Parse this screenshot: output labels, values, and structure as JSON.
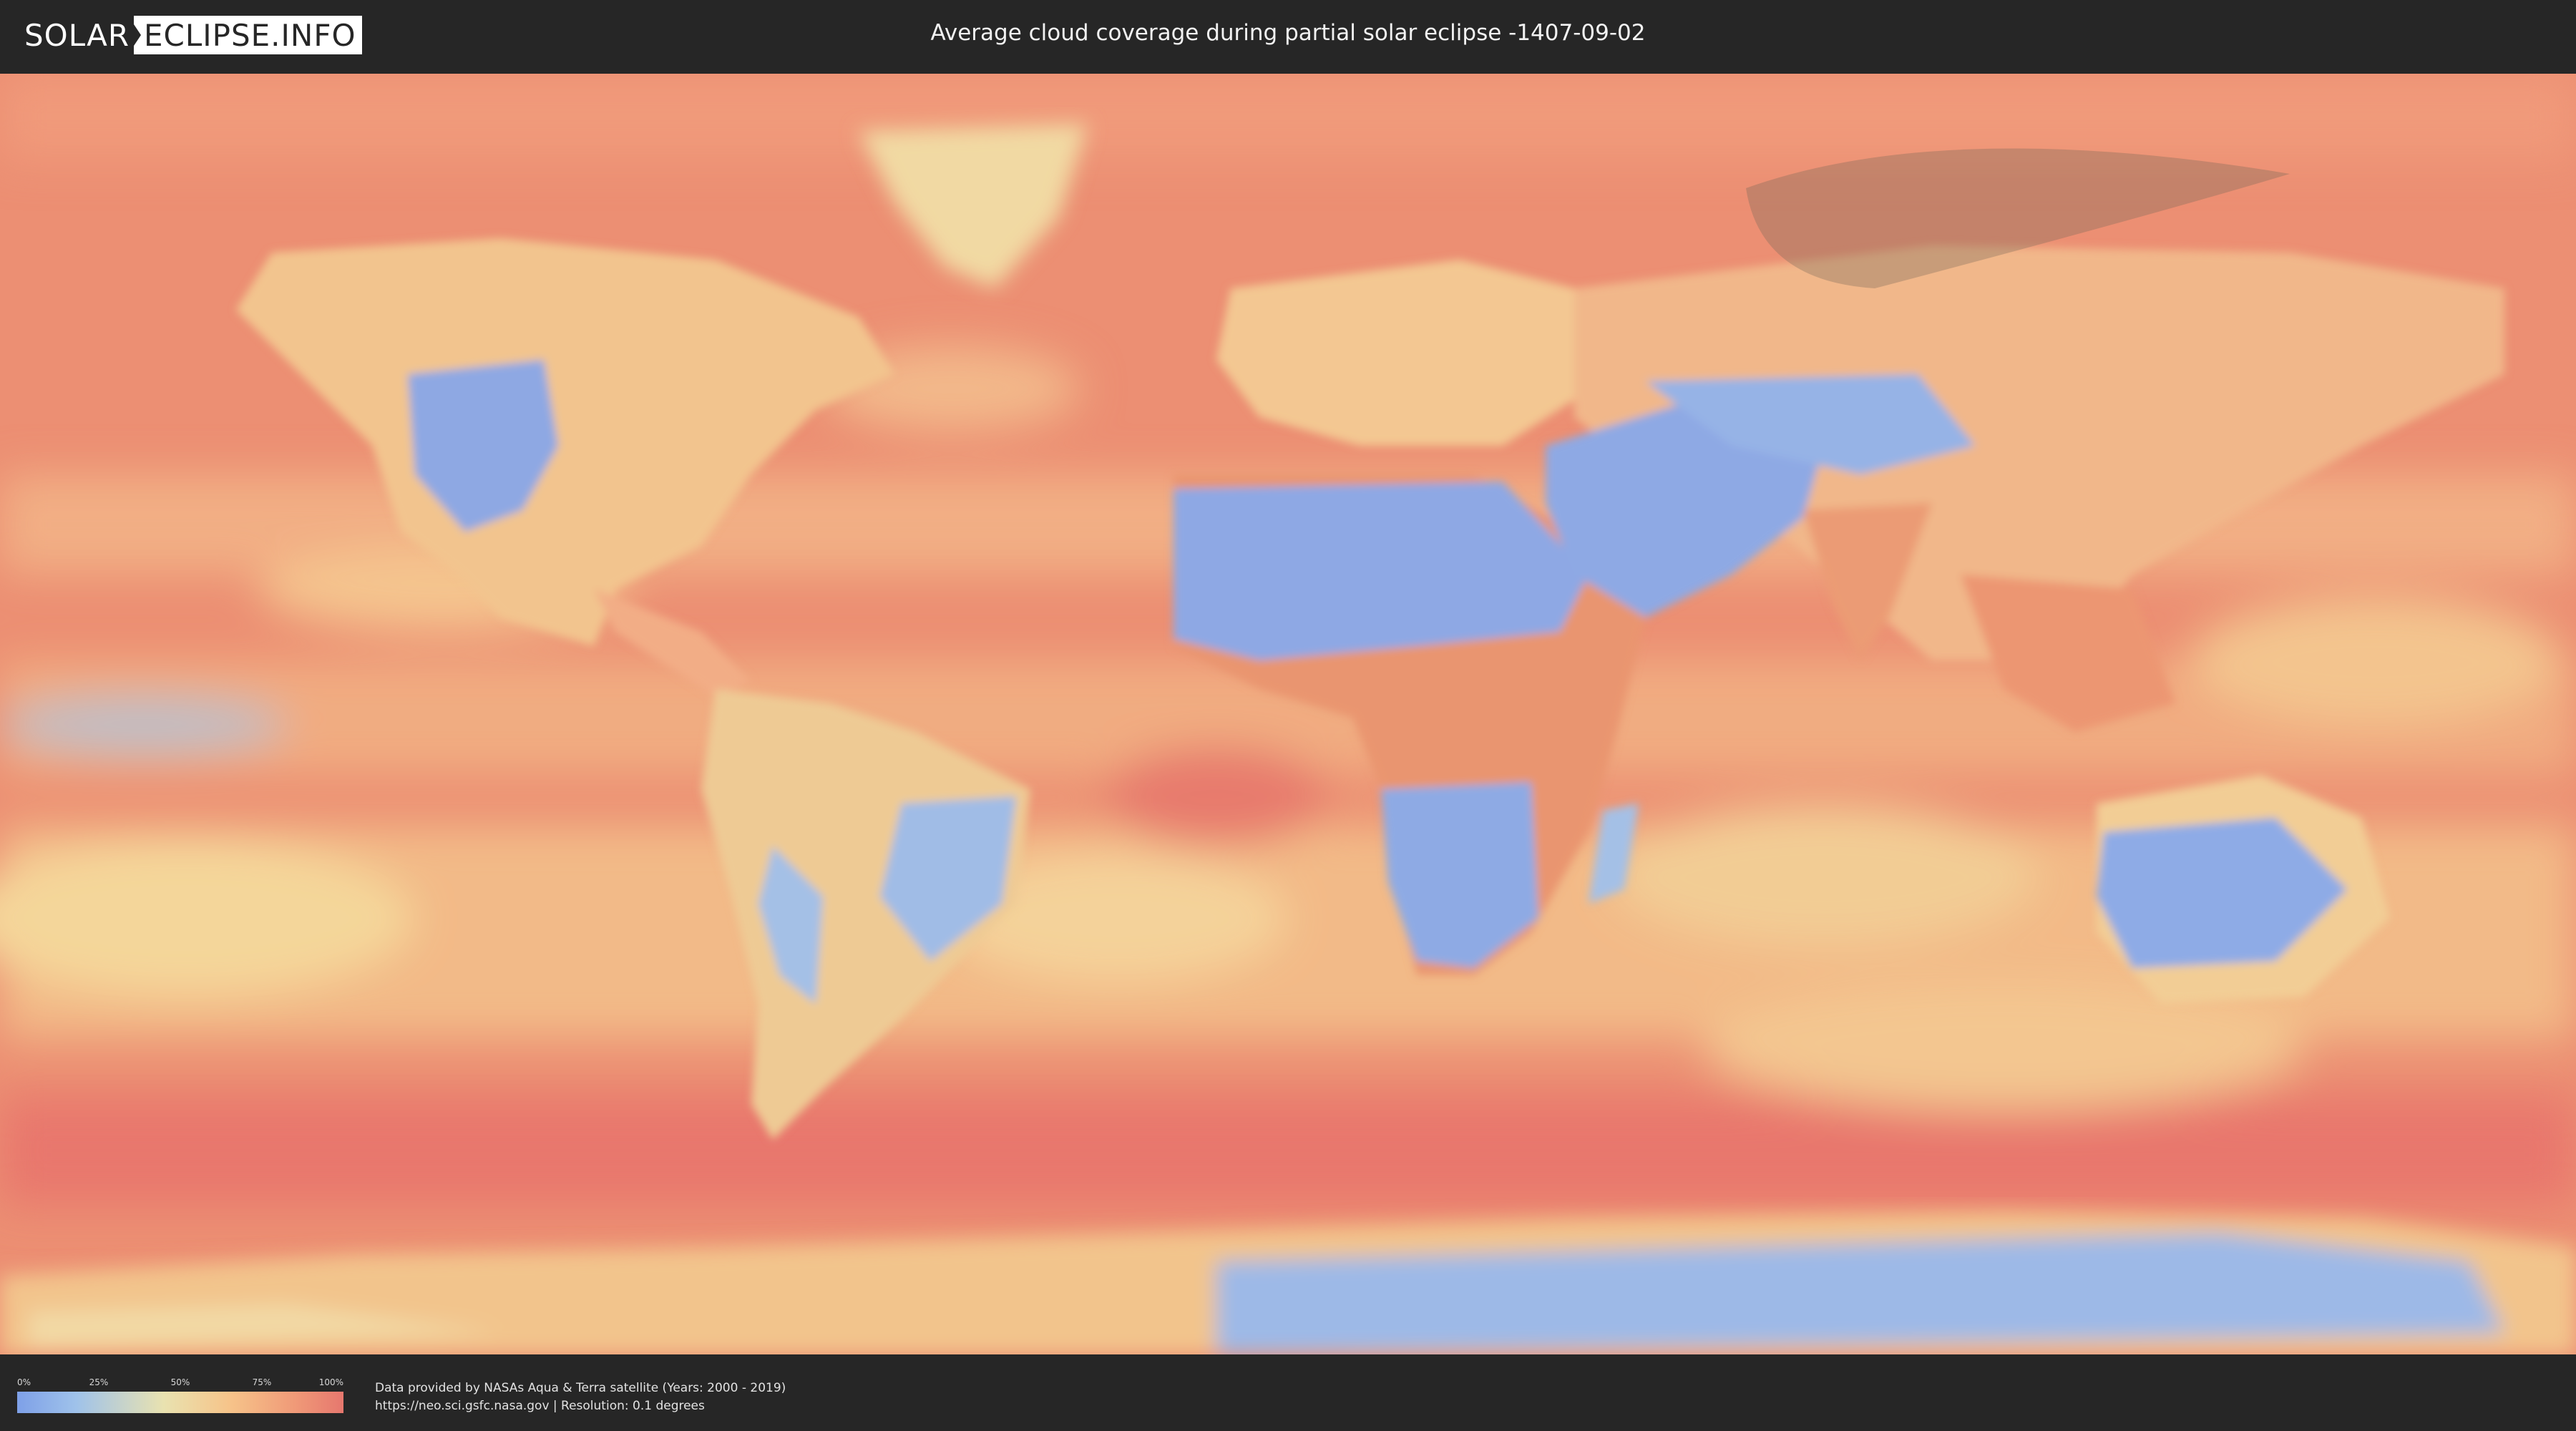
{
  "header": {
    "logo_part1": "SOLAR",
    "logo_part2": "ECLIPSE.INFO",
    "title": "Average cloud coverage during partial solar eclipse -1407-09-02"
  },
  "map": {
    "colors": {
      "clear": "#7ea0e8",
      "low": "#9fc2ea",
      "mid": "#e9e2b0",
      "high": "#f6c48a",
      "overcast": "#e6776e",
      "eclipse_zone": "#7a6a5a"
    },
    "icons": [
      "eclipse-zone-shape"
    ]
  },
  "legend": {
    "ticks": [
      "0%",
      "25%",
      "50%",
      "75%",
      "100%"
    ]
  },
  "credits": {
    "line1": "Data provided by NASAs Aqua & Terra satellite (Years: 2000 - 2019)",
    "line2": "https://neo.sci.gsfc.nasa.gov | Resolution: 0.1 degrees"
  }
}
